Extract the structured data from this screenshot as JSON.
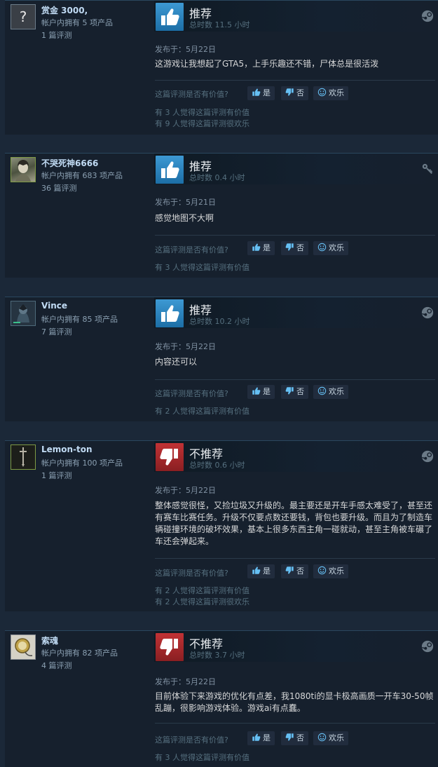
{
  "helpful_question": "这篇评测是否有价值?",
  "buttons": {
    "yes": "是",
    "no": "否",
    "funny": "欢乐"
  },
  "reviews": [
    {
      "author_name": "赏金 3000,",
      "products": "帐户内拥有 5 项产品",
      "review_count": "1 篇评测",
      "verdict": "推荐",
      "recommended": true,
      "hours": "总时数 11.5 小时",
      "posted": "发布于：5月22日",
      "text": "这游戏让我想起了GTA5，上手乐趣还不错，尸体总是很活泼",
      "helpful_lines": [
        "有 3 人觉得这篇评测有价值",
        "有 9 人觉得这篇评测很欢乐"
      ],
      "platform_icon": "steam-icon",
      "avatar_icon": "question-mark-avatar"
    },
    {
      "author_name": "不哭死神6666",
      "products": "帐户内拥有 683 项产品",
      "review_count": "36 篇评测",
      "verdict": "推荐",
      "recommended": true,
      "hours": "总时数 0.4 小时",
      "posted": "发布于：5月21日",
      "text": "感觉地图不大啊",
      "helpful_lines": [
        "有 3 人觉得这篇评测有价值"
      ],
      "platform_icon": "key-icon",
      "avatar_icon": "anime-character-avatar"
    },
    {
      "author_name": "Vince",
      "products": "帐户内拥有 85 项产品",
      "review_count": "7 篇评测",
      "verdict": "推荐",
      "recommended": true,
      "hours": "总时数 10.2 小时",
      "posted": "发布于：5月22日",
      "text": "内容还可以",
      "helpful_lines": [
        "有 2 人觉得这篇评测有价值"
      ],
      "platform_icon": "steam-icon",
      "avatar_icon": "dark-character-avatar"
    },
    {
      "author_name": "Lemon-ton",
      "products": "帐户内拥有 100 项产品",
      "review_count": "1 篇评测",
      "verdict": "不推荐",
      "recommended": false,
      "hours": "总时数 0.6 小时",
      "posted": "发布于：5月22日",
      "text": "整体感觉很怪，又捡垃圾又升级的。最主要还是开车手感太难受了，甚至还有赛车比赛任务。升级不仅要点数还要钱，背包也要升级。而且为了制造车辆碰撞环境的破坏效果，基本上很多东西主角一碰就动，甚至主角被车碾了车还会弹起来。",
      "helpful_lines": [
        "有 2 人觉得这篇评测有价值",
        "有 2 人觉得这篇评测很欢乐"
      ],
      "platform_icon": "steam-icon",
      "avatar_icon": "sword-avatar"
    },
    {
      "author_name": "索魂",
      "products": "帐户内拥有 82 项产品",
      "review_count": "4 篇评测",
      "verdict": "不推荐",
      "recommended": false,
      "hours": "总时数 3.7 小时",
      "posted": "发布于：5月22日",
      "text": "目前体验下来游戏的优化有点差，我1080ti的显卡极高画质一开车30-50帧乱蹦，很影响游戏体验。游戏ai有点蠢。",
      "helpful_lines": [
        "有 3 人觉得这篇评测有价值"
      ],
      "platform_icon": "steam-icon",
      "avatar_icon": "pocket-watch-avatar"
    }
  ]
}
